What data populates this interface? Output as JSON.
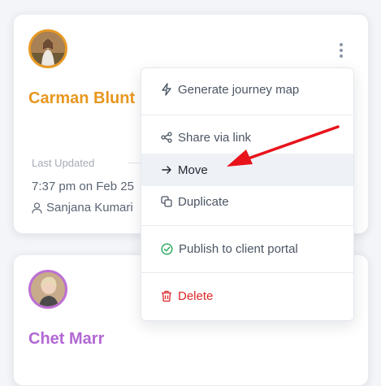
{
  "cards": [
    {
      "name": "Carman Blunt",
      "last_updated_label": "Last Updated",
      "date": "7:37 pm on Feb 25",
      "user": "Sanjana Kumari",
      "accent": "#e8971f"
    },
    {
      "name": "Chet Marr",
      "accent": "#b268d4"
    }
  ],
  "menu": {
    "items": [
      {
        "label": "Generate journey map",
        "icon": "lightning-icon"
      },
      {
        "label": "Share via link",
        "icon": "share-icon"
      },
      {
        "label": "Move",
        "icon": "arrow-right-icon",
        "highlighted": true
      },
      {
        "label": "Duplicate",
        "icon": "duplicate-icon"
      },
      {
        "label": "Publish to client portal",
        "icon": "check-circle-icon"
      },
      {
        "label": "Delete",
        "icon": "trash-icon",
        "color": "#dc2626"
      }
    ]
  },
  "colors": {
    "annotation_arrow": "#e8131b",
    "publish_icon": "#22a85a",
    "delete_icon": "#dc2626"
  }
}
